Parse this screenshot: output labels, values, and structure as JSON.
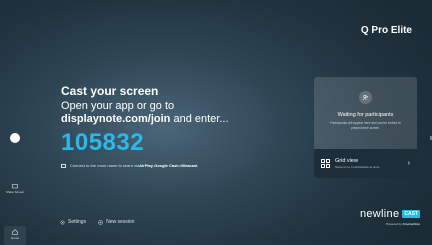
{
  "header": {
    "room_name": "Q Pro Elite"
  },
  "cast": {
    "title": "Cast your screen",
    "line1": "Open your app or go to",
    "url": "displaynote.com/join",
    "line2_suffix": " and enter...",
    "code": "105832",
    "connect_prefix": "Connect to the room name to share via ",
    "airplay": "AirPlay",
    "google_cast": "Google Cast",
    "or_text": " or ",
    "miracast": "Miracast"
  },
  "participants": {
    "title": "Waiting for participants",
    "description": "Participants will appear here and can be invited to present their screen.",
    "grid_title": "Grid view",
    "grid_subtitle": "Show up to 4 participants at once"
  },
  "sidebar": {
    "share_label": "Share Screen",
    "home_label": "Home"
  },
  "footer": {
    "settings_label": "Settings",
    "new_session_label": "New session"
  },
  "brand": {
    "name": "newline",
    "badge": "CAST",
    "powered_prefix": "Powered by ",
    "powered_brand": "DisplayNote"
  },
  "colors": {
    "accent": "#2bb8ea",
    "background": "#2f4655",
    "panel_dark": "#1d2e3a"
  },
  "icons": [
    "screen-icon",
    "people-icon",
    "grid-icon",
    "chevron-right-icon",
    "share-screen-icon",
    "home-icon",
    "gear-icon",
    "plus-circle-icon"
  ]
}
